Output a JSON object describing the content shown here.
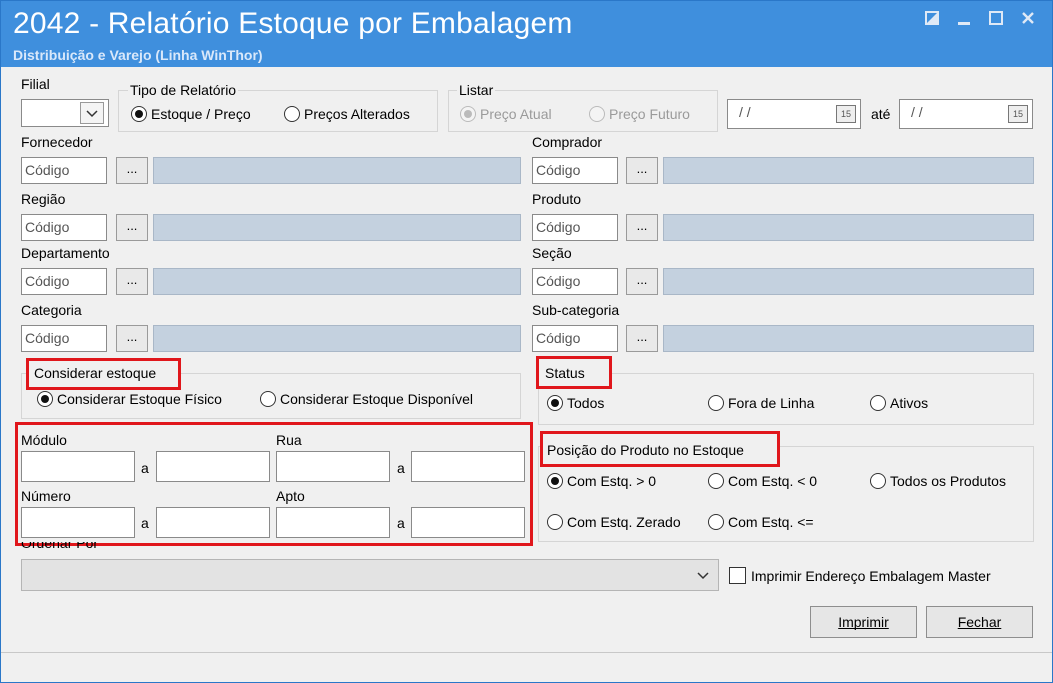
{
  "window": {
    "title": "2042 - Relatório Estoque por Embalagem",
    "subtitle": "Distribuição e Varejo (Linha WinThor)",
    "controls": [
      "restore",
      "minimize",
      "maximize",
      "close"
    ]
  },
  "filial": {
    "label": "Filial",
    "value": ""
  },
  "tipo_relatorio": {
    "label": "Tipo de Relatório",
    "options": [
      "Estoque / Preço",
      "Preços Alterados"
    ],
    "selected": "Estoque / Preço"
  },
  "listar": {
    "label": "Listar",
    "options": [
      "Preço Atual",
      "Preço Futuro"
    ],
    "selected": "Preço Atual",
    "date_from": "/ /",
    "date_sep": "até",
    "date_to": "/ /",
    "cal_icon_text": "15"
  },
  "lookups": {
    "placeholder": "Código",
    "dots": "...",
    "fornecedor": "Fornecedor",
    "regiao": "Região",
    "departamento": "Departamento",
    "categoria": "Categoria",
    "comprador": "Comprador",
    "produto": "Produto",
    "secao": "Seção",
    "subcategoria": "Sub-categoria"
  },
  "considerar_estoque": {
    "label": "Considerar estoque",
    "options": [
      "Considerar Estoque Físico",
      "Considerar Estoque Disponível"
    ],
    "selected": "Considerar Estoque Físico"
  },
  "status": {
    "label": "Status",
    "options": [
      "Todos",
      "Fora de Linha",
      "Ativos"
    ],
    "selected": "Todos"
  },
  "endereco": {
    "modulo": "Módulo",
    "rua": "Rua",
    "numero": "Número",
    "apto": "Apto",
    "sep": "a"
  },
  "posicao": {
    "label": "Posição do Produto no Estoque",
    "options": [
      "Com Estq. > 0",
      "Com Estq. < 0",
      "Todos os Produtos",
      "Com Estq. Zerado",
      "Com Estq. <="
    ],
    "selected": "Com Estq. > 0"
  },
  "ordenar": {
    "label": "Ordenar Por",
    "value": ""
  },
  "imprimir_master": {
    "label": "Imprimir Endereço Embalagem Master",
    "checked": false
  },
  "buttons": {
    "imprimir": "Imprimir",
    "fechar": "Fechar"
  },
  "colors": {
    "title_bar": "#3f8fdd",
    "highlight": "#e0161b",
    "readonly_field": "#c4d1df"
  }
}
